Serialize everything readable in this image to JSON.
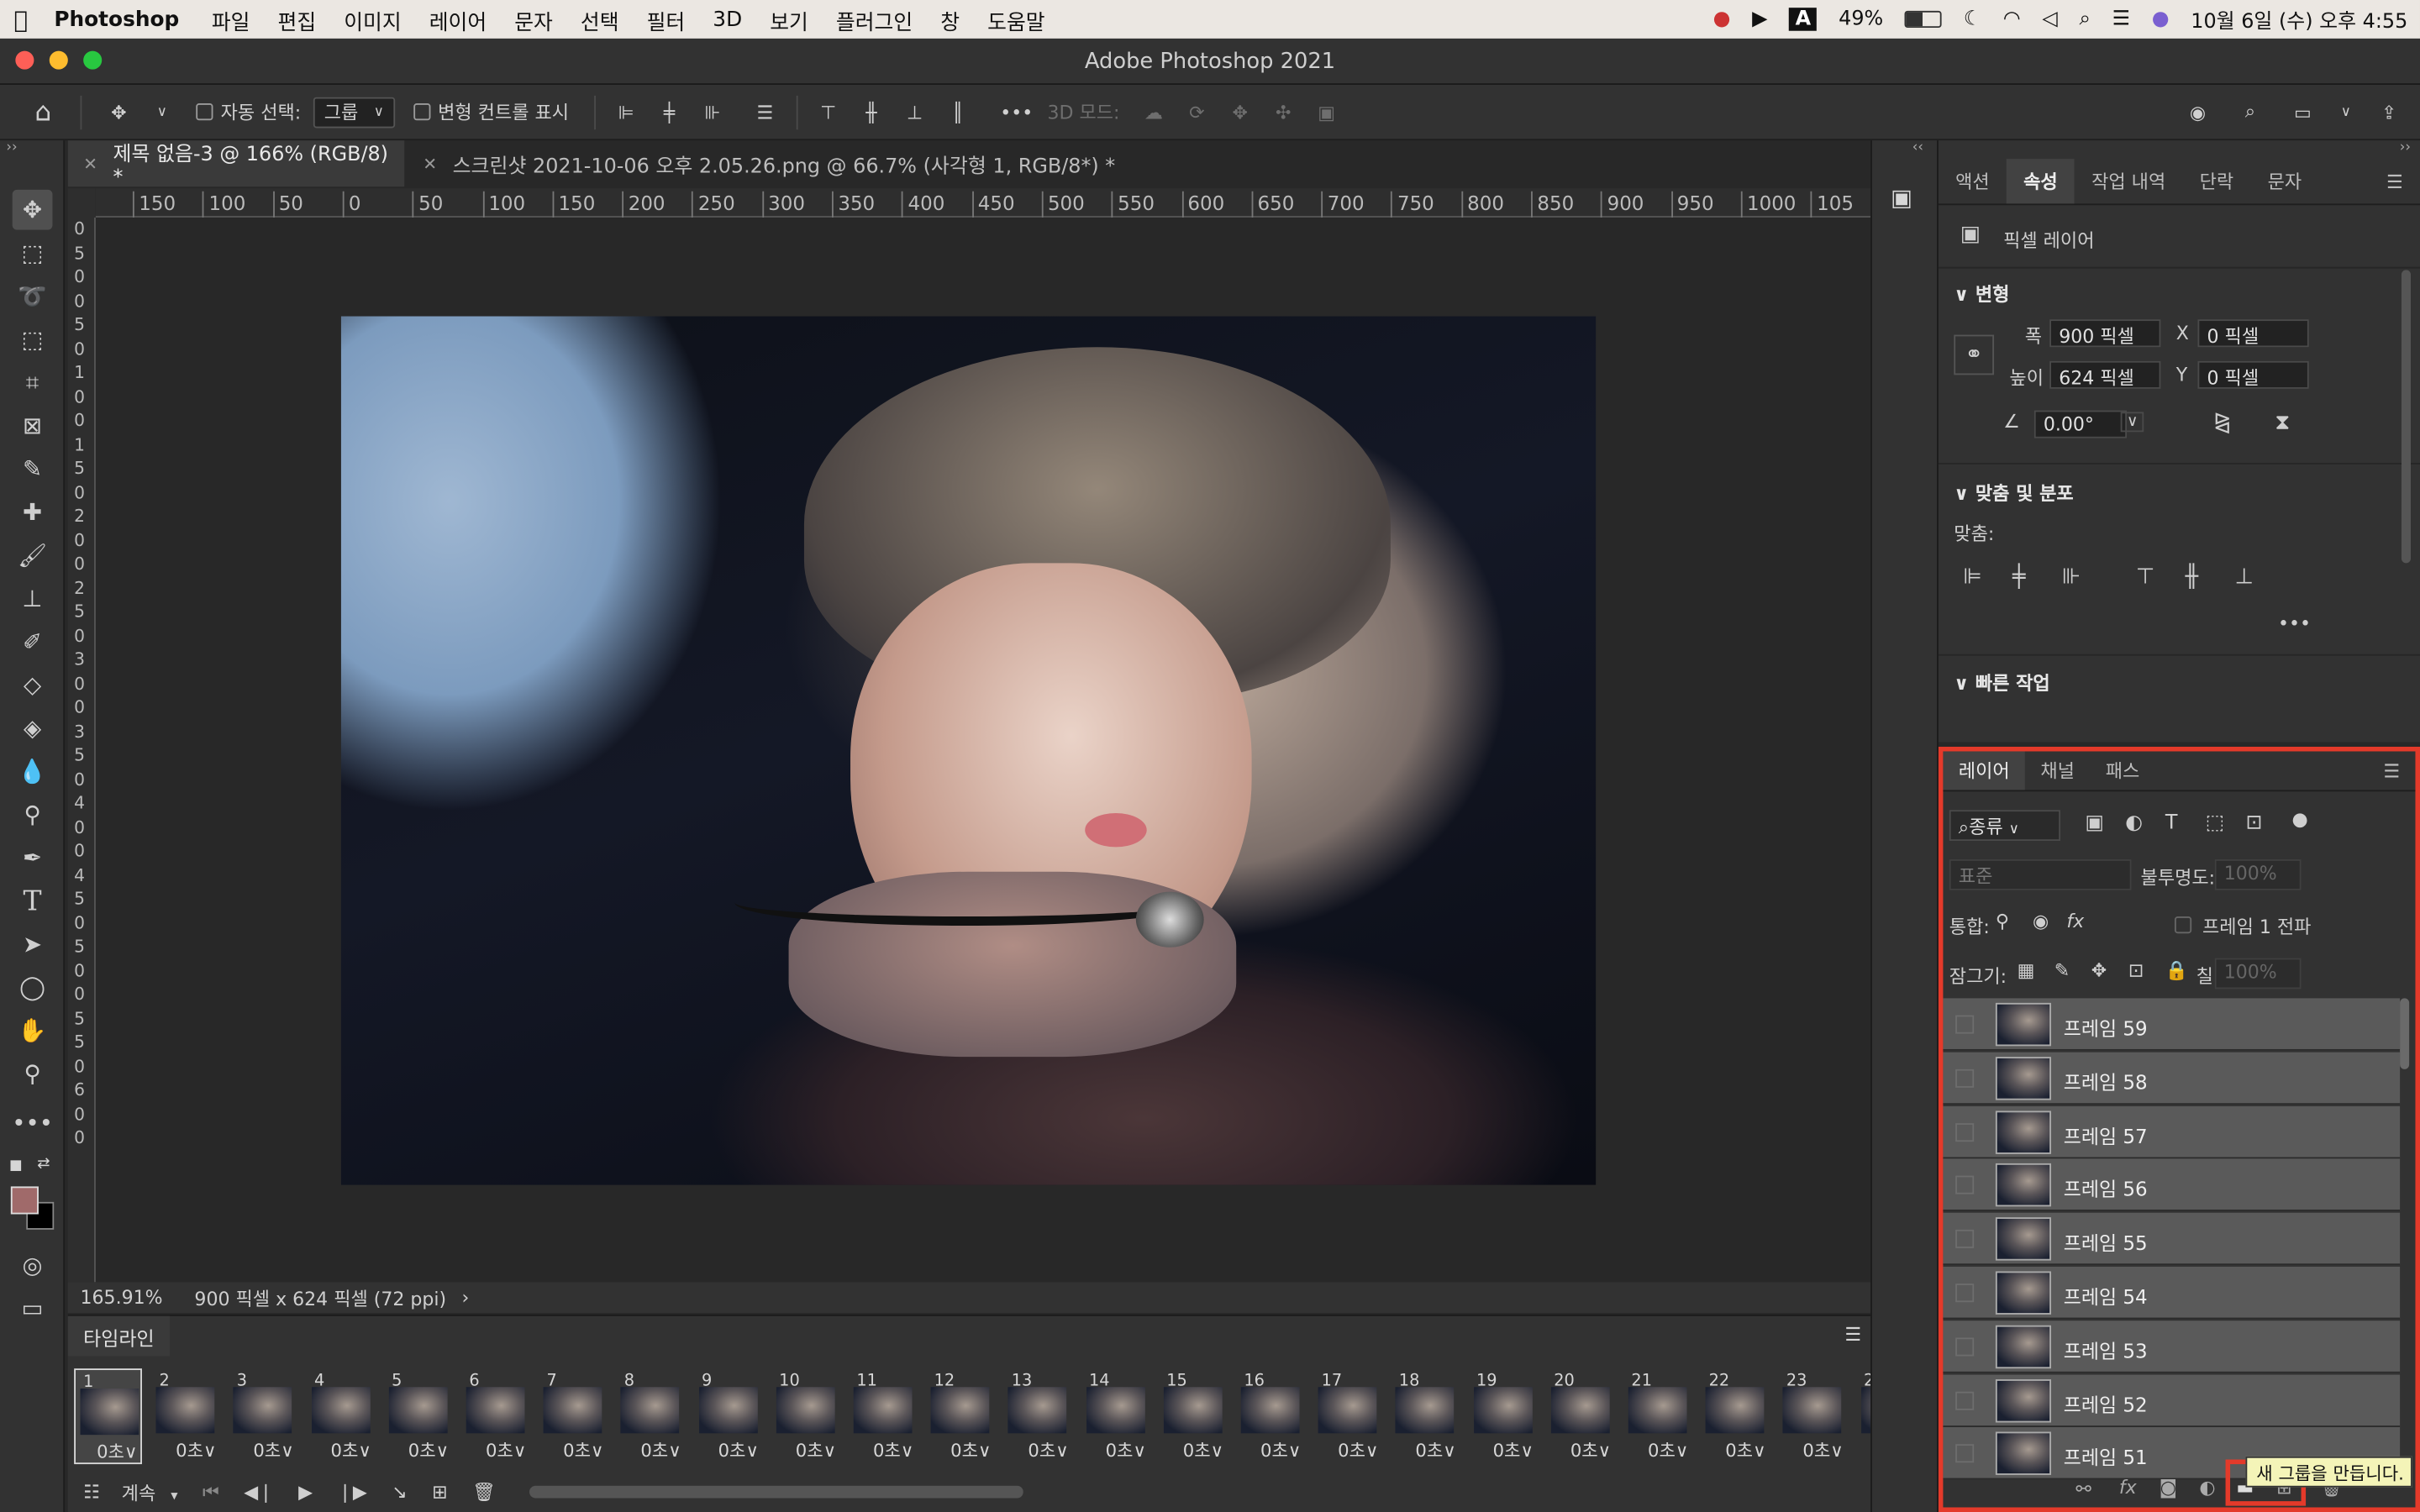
{
  "menubar": {
    "app": "Photoshop",
    "items": [
      "파일",
      "편집",
      "이미지",
      "레이어",
      "문자",
      "선택",
      "필터",
      "3D",
      "보기",
      "플러그인",
      "창",
      "도움말"
    ],
    "battery": "49%",
    "datetime": "10월 6일 (수) 오후 4:55",
    "input_badge": "A"
  },
  "window": {
    "title": "Adobe Photoshop 2021"
  },
  "options": {
    "auto_select_label": "자동 선택:",
    "auto_select_value": "그룹",
    "transform_label": "변형 컨트롤 표시",
    "mode_3d_label": "3D 모드:"
  },
  "tabs": [
    {
      "label": "제목 없음-3 @ 166% (RGB/8) *"
    },
    {
      "label": "스크린샷 2021-10-06 오후 2.05.26.png @ 66.7% (사각형 1, RGB/8*) *"
    }
  ],
  "ruler": {
    "h": [
      "150",
      "100",
      "50",
      "0",
      "50",
      "100",
      "150",
      "200",
      "250",
      "300",
      "350",
      "400",
      "450",
      "500",
      "550",
      "600",
      "650",
      "700",
      "750",
      "800",
      "850",
      "900",
      "950",
      "1000",
      "105"
    ],
    "v": [
      "0",
      "5",
      "0",
      "0",
      "5",
      "0",
      "1",
      "0",
      "0",
      "1",
      "5",
      "0",
      "2",
      "0",
      "0",
      "2",
      "5",
      "0",
      "3",
      "0",
      "0",
      "3",
      "5",
      "0",
      "4",
      "0",
      "0",
      "4",
      "5",
      "0",
      "5",
      "0",
      "0",
      "5",
      "5",
      "0",
      "6",
      "0",
      "0"
    ]
  },
  "statusbar": {
    "zoom": "165.91%",
    "doc": "900 픽셀 x 624 픽셀 (72 ppi)"
  },
  "timeline": {
    "title": "타임라인",
    "loop": "계속",
    "frames": [
      "1",
      "2",
      "3",
      "4",
      "5",
      "6",
      "7",
      "8",
      "9",
      "10",
      "11",
      "12",
      "13",
      "14",
      "15",
      "16",
      "17",
      "18",
      "19",
      "20",
      "21",
      "22",
      "23",
      "2"
    ],
    "delay": "0초∨"
  },
  "properties": {
    "tabs": [
      "액션",
      "속성",
      "작업 내역",
      "단락",
      "문자"
    ],
    "layer_type": "픽셀 레이어",
    "transform": {
      "title": "변형",
      "w_label": "폭",
      "w": "900 픽셀",
      "h_label": "높이",
      "h": "624 픽셀",
      "x_label": "X",
      "x": "0 픽셀",
      "y_label": "Y",
      "y": "0 픽셀",
      "angle": "0.00°"
    },
    "align": {
      "title": "맞춤 및 분포",
      "label": "맞춤:"
    },
    "quick": {
      "title": "빠른 작업"
    }
  },
  "layers_panel": {
    "tabs": [
      "레이어",
      "채널",
      "패스"
    ],
    "filter": "종류",
    "blend": "표준",
    "opacity_label": "불투명도:",
    "opacity": "100%",
    "unify_label": "통합:",
    "propagate": "프레임 1 전파",
    "lock_label": "잠그기:",
    "fill_label": "칠:",
    "fill": "100%",
    "layers": [
      "프레임 59",
      "프레임 58",
      "프레임 57",
      "프레임 56",
      "프레임 55",
      "프레임 54",
      "프레임 53",
      "프레임 52",
      "프레임 51"
    ],
    "tooltip": "새 그룹을 만듭니다."
  }
}
